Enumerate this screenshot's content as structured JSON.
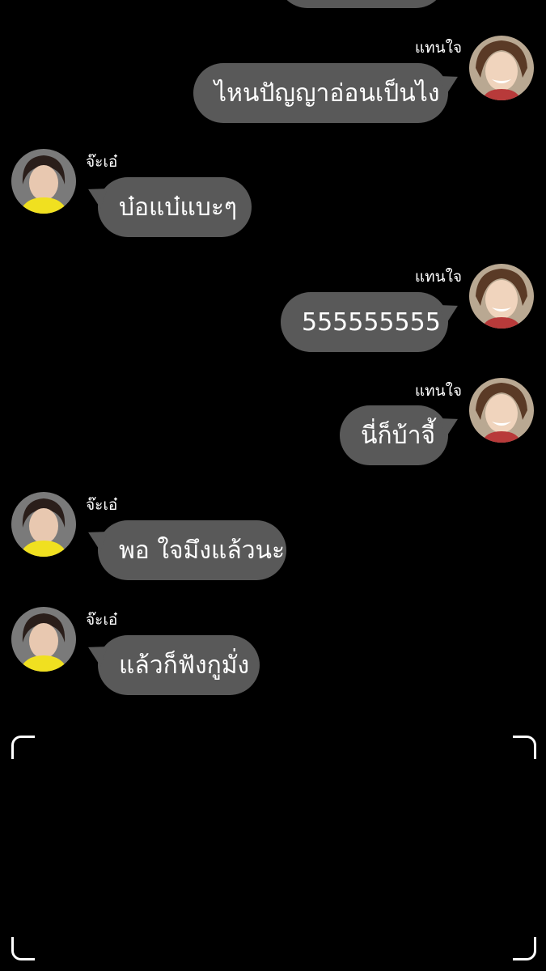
{
  "colors": {
    "background": "#000000",
    "bubble": "#595959",
    "text": "#ffffff"
  },
  "names": {
    "right": "แทนใจ",
    "left": "จ๊ะเอ๋"
  },
  "messages": [
    {
      "side": "right",
      "text": "ไหนปัญญาอ่อนเป็นไง"
    },
    {
      "side": "left",
      "text": "บ๋อแบ๋แบะๆ"
    },
    {
      "side": "right",
      "text": "555555555"
    },
    {
      "side": "right",
      "text": "นี่ก็บ้าจี้"
    },
    {
      "side": "left",
      "text": "พอ ใจมึงแล้วนะ"
    },
    {
      "side": "left",
      "text": "แล้วก็ฟังกูมั่ง"
    }
  ]
}
